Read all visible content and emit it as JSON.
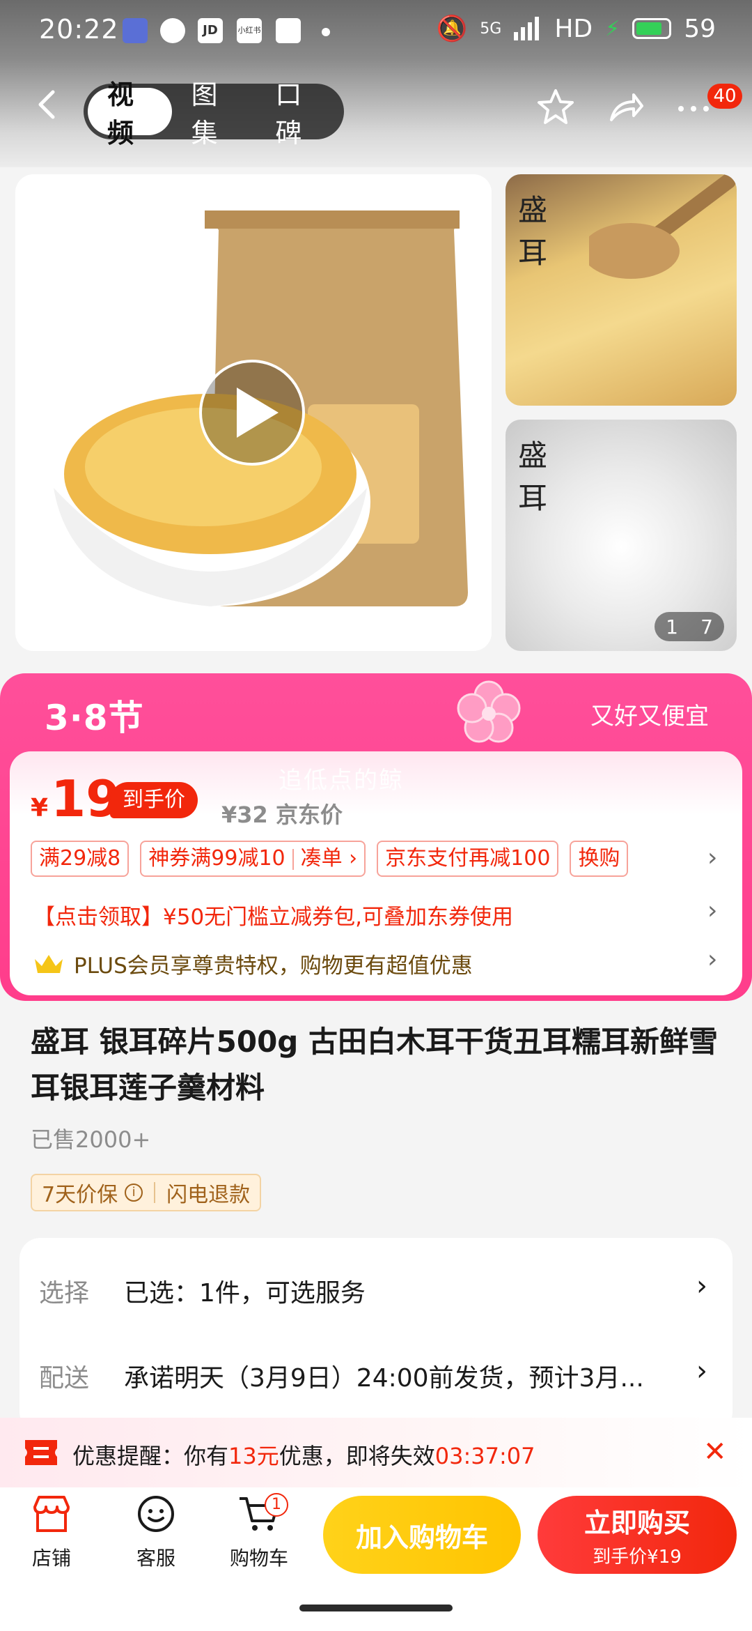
{
  "status_bar": {
    "time": "20:22",
    "network": "5G",
    "hd": "HD",
    "battery": "59",
    "app_badges": [
      "JD",
      "小红书"
    ]
  },
  "nav": {
    "tabs": [
      "视频",
      "图集",
      "口碑"
    ],
    "active_tab": "视频",
    "more_badge": "40"
  },
  "gallery": {
    "image_counter_current": "1",
    "image_counter_total": "7",
    "thumb_logo": "盛耳"
  },
  "promo": {
    "festival_logo": "3·8节",
    "slogan": "又好又便宜",
    "watermark": "追低点的鲸",
    "currency": "¥",
    "price": "19",
    "price_tag": "到手价",
    "original_price": "¥32 京东价",
    "chips": [
      "满29减8",
      "神券满99减10",
      "凑单 ›",
      "京东支付再减100",
      "换购"
    ],
    "coupon_line": "【点击领取】¥50无门槛立减券包,可叠加东券使用",
    "plus_line": "PLUS会员享尊贵特权，购物更有超值优惠"
  },
  "product": {
    "title": "盛耳 银耳碎片500g 古田白木耳干货丑耳糯耳新鲜雪耳银耳莲子羹材料",
    "sold": "已售2000+",
    "guarantee_1": "7天价保",
    "guarantee_2": "闪电退款"
  },
  "options": {
    "select_label": "选择",
    "select_value": "已选：1件，可选服务",
    "delivery_label": "配送",
    "delivery_value": "承诺明天（3月9日）24:00前发货，预计3月..."
  },
  "reminder": {
    "prefix": "优惠提醒：你有",
    "amount": "13元",
    "middle": "优惠，即将失效",
    "countdown": "03:37:07"
  },
  "bottom_bar": {
    "store": "店铺",
    "service": "客服",
    "cart": "购物车",
    "cart_count": "1",
    "add_to_cart": "加入购物车",
    "buy_now": "立即购买",
    "buy_now_sub": "到手价¥19"
  },
  "colors": {
    "brand_red": "#f2270c",
    "promo_pink": "#ff3d8b",
    "cart_yellow": "#ffc400"
  }
}
